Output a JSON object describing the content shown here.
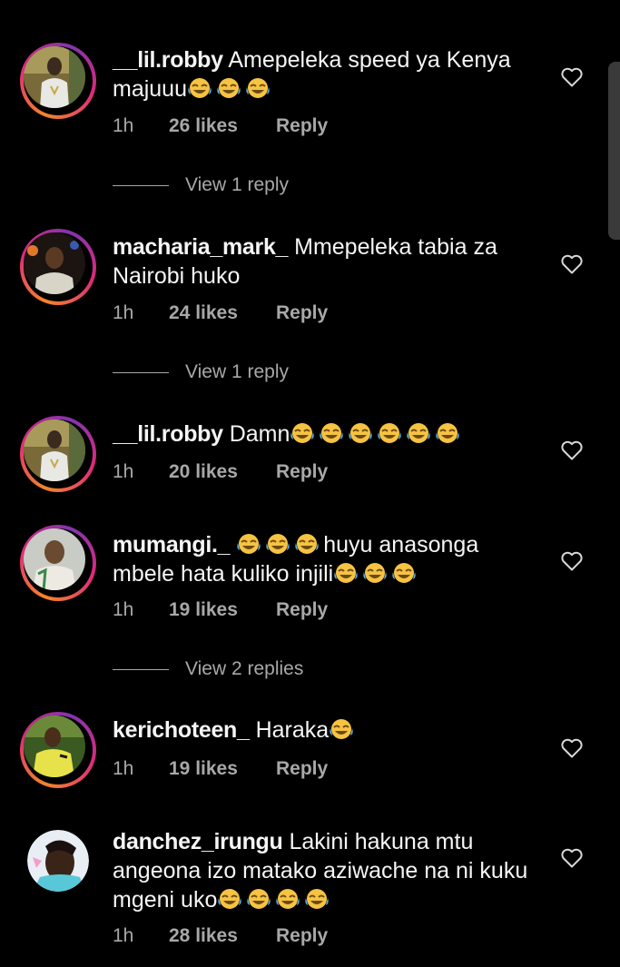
{
  "comments": [
    {
      "username": "__lil.robby",
      "text": "Amepeleka speed ya Kenya majuuu😂😂😂",
      "time": "1h",
      "likes": "26 likes",
      "reply_label": "Reply",
      "view_replies": "View 1 reply",
      "story_ring": true
    },
    {
      "username": "macharia_mark_",
      "text": "Mmepeleka tabia za Nairobi huko",
      "time": "1h",
      "likes": "24 likes",
      "reply_label": "Reply",
      "view_replies": "View 1 reply",
      "story_ring": true
    },
    {
      "username": "__lil.robby",
      "text": "Damn😂😂😂😂😂😂",
      "time": "1h",
      "likes": "20 likes",
      "reply_label": "Reply",
      "story_ring": true
    },
    {
      "username": "mumangi._",
      "text": "😂😂😂huyu anasonga mbele hata kuliko injili😂😂😂",
      "time": "1h",
      "likes": "19 likes",
      "reply_label": "Reply",
      "view_replies": "View 2 replies",
      "story_ring": true
    },
    {
      "username": "kerichoteen_",
      "text": "Haraka😂",
      "time": "1h",
      "likes": "19 likes",
      "reply_label": "Reply",
      "story_ring": true
    },
    {
      "username": "danchez_irungu",
      "text": "Lakini hakuna mtu angeona izo matako aziwache na ni kuku mgeni uko😂😂😂😂",
      "time": "1h",
      "likes": "28 likes",
      "reply_label": "Reply",
      "story_ring": false
    }
  ],
  "icons": {
    "like": "heart-outline-icon",
    "emoji": "face-with-tears-of-joy"
  },
  "colors": {
    "background": "#000000",
    "text_primary": "#f5f5f5",
    "text_secondary": "#a8a8a8",
    "story_ring_start": "#f58529",
    "story_ring_end": "#dd2a7b"
  }
}
